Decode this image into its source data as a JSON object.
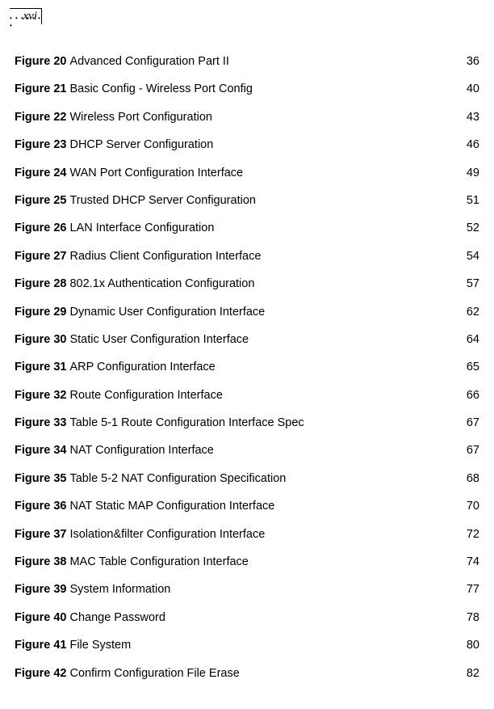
{
  "page_number": "xvi",
  "entries": [
    {
      "label": "Figure 20",
      "title": "Advanced Configuration Part II",
      "page": "36"
    },
    {
      "label": "Figure 21",
      "title": "Basic Config - Wireless Port Config",
      "page": "40"
    },
    {
      "label": "Figure 22",
      "title": "Wireless Port Configuration",
      "page": "43"
    },
    {
      "label": "Figure 23",
      "title": "DHCP Server Configuration",
      "page": "46"
    },
    {
      "label": "Figure 24",
      "title": "WAN Port Configuration Interface",
      "page": "49"
    },
    {
      "label": "Figure 25",
      "title": "Trusted DHCP Server Configuration",
      "page": "51"
    },
    {
      "label": "Figure 26",
      "title": "LAN Interface Configuration",
      "page": "52"
    },
    {
      "label": "Figure 27",
      "title": "Radius Client Configuration Interface",
      "page": "54"
    },
    {
      "label": "Figure 28",
      "title": "802.1x Authentication Configuration",
      "page": "57"
    },
    {
      "label": "Figure 29",
      "title": "Dynamic User Configuration Interface",
      "page": "62"
    },
    {
      "label": "Figure 30",
      "title": "Static User Configuration Interface",
      "page": "64"
    },
    {
      "label": "Figure 31",
      "title": "ARP Configuration Interface",
      "page": "65"
    },
    {
      "label": "Figure 32",
      "title": "Route Configuration Interface",
      "page": "66"
    },
    {
      "label": "Figure 33",
      "title": "Table 5-1 Route Configuration Interface Spec",
      "page": "67"
    },
    {
      "label": "Figure 34",
      "title": "NAT Configuration Interface",
      "page": "67"
    },
    {
      "label": "Figure 35",
      "title": "Table 5-2 NAT Configuration Specification",
      "page": "68"
    },
    {
      "label": "Figure 36",
      "title": "NAT Static MAP Configuration Interface",
      "page": "70"
    },
    {
      "label": "Figure 37",
      "title": "Isolation&filter Configuration Interface",
      "page": "72"
    },
    {
      "label": "Figure 38",
      "title": "MAC Table Configuration Interface",
      "page": "74"
    },
    {
      "label": "Figure 39",
      "title": "System Information",
      "page": "77"
    },
    {
      "label": "Figure 40",
      "title": "Change Password",
      "page": "78"
    },
    {
      "label": "Figure 41",
      "title": "File System",
      "page": "80"
    },
    {
      "label": "Figure 42",
      "title": "Confirm Configuration File Erase",
      "page": "82"
    }
  ]
}
